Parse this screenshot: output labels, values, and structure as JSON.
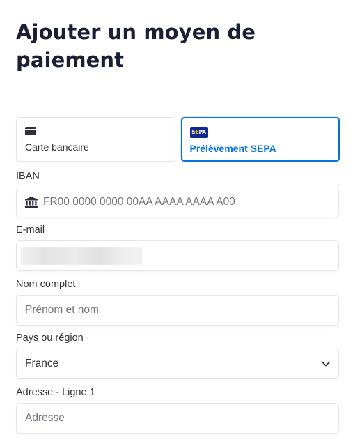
{
  "page": {
    "title": "Ajouter un moyen de paiement"
  },
  "payment_methods": [
    {
      "label": "Carte bancaire",
      "icon": "credit-card-icon",
      "selected": false
    },
    {
      "label": "Prélèvement SEPA",
      "icon": "sepa-logo-icon",
      "selected": true,
      "logo_text": "S€PA"
    }
  ],
  "iban": {
    "label": "IBAN",
    "placeholder": "FR00 0000 0000 00AA AAAA AAAA A00",
    "icon": "bank-icon"
  },
  "email": {
    "label": "E-mail",
    "value_state": "blurred"
  },
  "full_name": {
    "label": "Nom complet",
    "placeholder": "Prénom et nom"
  },
  "country": {
    "label": "Pays ou région",
    "value": "France",
    "icon": "chevron-down-icon"
  },
  "address_line1": {
    "label": "Adresse - Ligne 1",
    "placeholder": "Adresse"
  },
  "colors": {
    "accent": "#0570de",
    "text": "#30313d",
    "border": "#e6e6e6",
    "sepa_blue": "#10298e",
    "sepa_yellow": "#ffcc00"
  }
}
